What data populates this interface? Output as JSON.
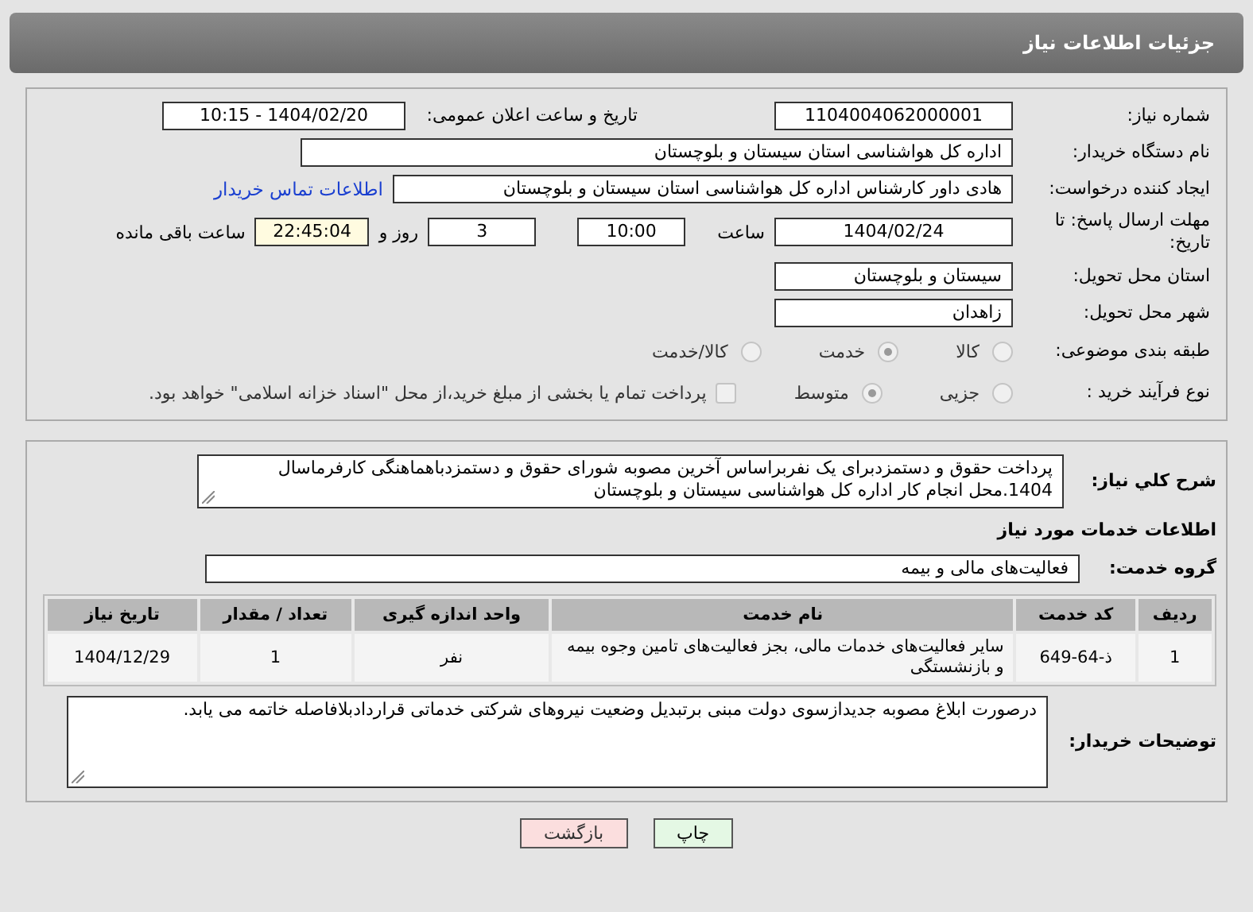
{
  "header": {
    "title": "جزئیات اطلاعات نیاز"
  },
  "details": {
    "need_number": {
      "label": "شماره نیاز:",
      "value": "1104004062000001"
    },
    "announce_date": {
      "label": "تاریخ و ساعت اعلان عمومی:",
      "value": "1404/02/20 - 10:15"
    },
    "buyer_org": {
      "label": "نام دستگاه خریدار:",
      "value": "اداره کل هواشناسی استان سیستان و بلوچستان"
    },
    "requester": {
      "label": "ایجاد کننده درخواست:",
      "value": "هادی داور کارشناس اداره کل هواشناسی استان سیستان و بلوچستان",
      "link": "اطلاعات تماس خریدار"
    },
    "deadline": {
      "label": "مهلت ارسال پاسخ: تا تاریخ:",
      "date": "1404/02/24",
      "time_label": "ساعت",
      "time": "10:00",
      "days": "3",
      "days_label": "روز و",
      "remaining": "22:45:04",
      "remaining_label": "ساعت باقی مانده"
    },
    "province": {
      "label": "استان محل تحویل:",
      "value": "سیستان و بلوچستان"
    },
    "city": {
      "label": "شهر محل تحویل:",
      "value": "زاهدان"
    },
    "category": {
      "label": "طبقه بندی موضوعی:",
      "options": [
        {
          "label": "کالا",
          "selected": false
        },
        {
          "label": "خدمت",
          "selected": true
        },
        {
          "label": "کالا/خدمت",
          "selected": false
        }
      ]
    },
    "process": {
      "label": "نوع فرآیند خرید :",
      "options": [
        {
          "label": "جزیی",
          "selected": false
        },
        {
          "label": "متوسط",
          "selected": true
        }
      ],
      "payment": {
        "label": "پرداخت تمام یا بخشی از مبلغ خرید،از محل \"اسناد خزانه اسلامی\" خواهد بود.",
        "checked": false
      }
    }
  },
  "services": {
    "description": {
      "label": "شرح کلي نیاز:",
      "value": "پرداخت حقوق و دستمزدبرای یک نفربراساس آخرین مصوبه شورای حقوق و دستمزدباهماهنگی کارفرماسال 1404.محل انجام کار اداره کل هواشناسی سیستان و بلوچستان"
    },
    "heading": "اطلاعات خدمات مورد نیاز",
    "group": {
      "label": "گروه خدمت:",
      "value": "فعالیت‌های مالی و بیمه"
    },
    "table": {
      "columns": [
        "ردیف",
        "کد خدمت",
        "نام خدمت",
        "واحد اندازه گیری",
        "تعداد / مقدار",
        "تاریخ نیاز"
      ],
      "rows": [
        [
          "1",
          "ذ-64-649",
          "سایر فعالیت‌های خدمات مالی، بجز فعالیت‌های تامین وجوه بیمه و بازنشستگی",
          "نفر",
          "1",
          "1404/12/29"
        ]
      ]
    },
    "buyer_notes": {
      "label": "توضیحات خریدار:",
      "value": "درصورت ابلاغ مصوبه جدیدازسوی دولت مبنی برتبدیل وضعیت نیروهای شرکتی خدماتی قراردادبلافاصله خاتمه می یابد."
    }
  },
  "buttons": [
    {
      "label": "چاپ",
      "kind": "print"
    },
    {
      "label": "بازگشت",
      "kind": "back"
    }
  ]
}
